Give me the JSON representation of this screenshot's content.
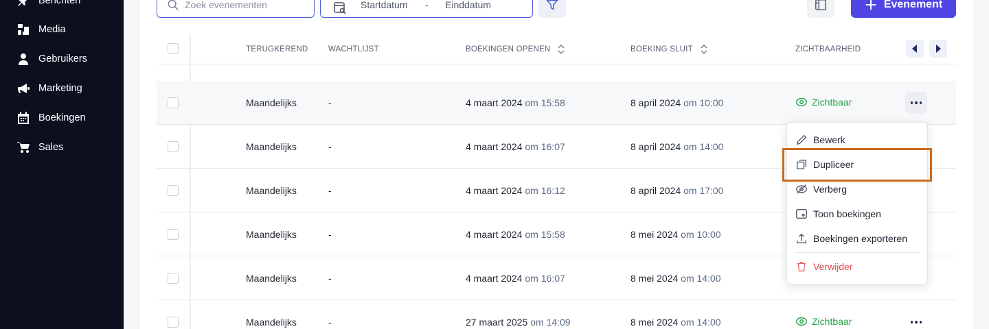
{
  "sidebar": {
    "items": [
      {
        "label": "Berichten",
        "icon": "pin-icon"
      },
      {
        "label": "Media",
        "icon": "media-icon"
      },
      {
        "label": "Gebruikers",
        "icon": "user-icon"
      },
      {
        "label": "Marketing",
        "icon": "megaphone-icon"
      },
      {
        "label": "Boekingen",
        "icon": "calendar-icon"
      },
      {
        "label": "Sales",
        "icon": "cart-icon"
      }
    ]
  },
  "toolbar": {
    "search_placeholder": "Zoek evenementen",
    "start_date": "Startdatum",
    "date_separator": "-",
    "end_date": "Einddatum",
    "add_label": "Evenement"
  },
  "table": {
    "headers": {
      "recurring": "TERUGKEREND",
      "waitlist": "WACHTLIJST",
      "booking_opens": "BOEKINGEN OPENEN",
      "booking_closes": "BOEKING SLUIT",
      "visibility": "ZICHTBAARHEID"
    },
    "rows": [
      {
        "recurring": "Maandelijks",
        "waitlist": "-",
        "open_date": "4 maart 2024",
        "open_time": "om 15:58",
        "close_date": "8 april 2024",
        "close_time": "om 10:00",
        "visibility": "Zichtbaar"
      },
      {
        "recurring": "Maandelijks",
        "waitlist": "-",
        "open_date": "4 maart 2024",
        "open_time": "om 16:07",
        "close_date": "8 april 2024",
        "close_time": "om 14:00",
        "visibility": ""
      },
      {
        "recurring": "Maandelijks",
        "waitlist": "-",
        "open_date": "4 maart 2024",
        "open_time": "om 16:12",
        "close_date": "8 april 2024",
        "close_time": "om 17:00",
        "visibility": ""
      },
      {
        "recurring": "Maandelijks",
        "waitlist": "-",
        "open_date": "4 maart 2024",
        "open_time": "om 15:58",
        "close_date": "8 mei 2024",
        "close_time": "om 10:00",
        "visibility": ""
      },
      {
        "recurring": "Maandelijks",
        "waitlist": "-",
        "open_date": "4 maart 2024",
        "open_time": "om 16:07",
        "close_date": "8 mei 2024",
        "close_time": "om 14:00",
        "visibility": ""
      },
      {
        "recurring": "Maandelijks",
        "waitlist": "-",
        "open_date": "27 maart 2025",
        "open_time": "om 14:09",
        "close_date": "8 mei 2024",
        "close_time": "om 14:00",
        "visibility": "Zichtbaar"
      }
    ]
  },
  "menu": {
    "edit": "Bewerk",
    "duplicate": "Dupliceer",
    "hide": "Verberg",
    "show_bookings": "Toon boekingen",
    "export_bookings": "Boekingen exporteren",
    "delete": "Verwijder"
  },
  "colors": {
    "accent": "#4f46e5",
    "visible_green": "#22a447",
    "danger": "#e04848",
    "highlight": "#cc6a1a",
    "sidebar_bg": "#0b0f1e"
  }
}
